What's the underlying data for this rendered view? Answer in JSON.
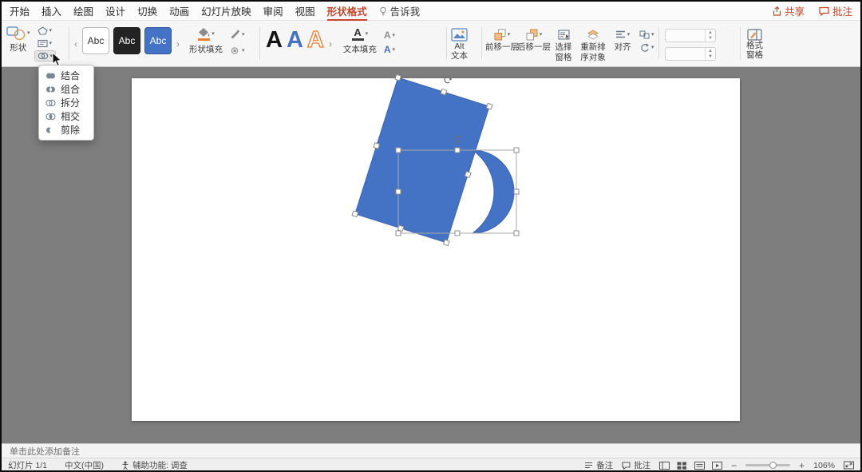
{
  "colors": {
    "accent_red": "#C8442C",
    "shape_blue": "#4472C4",
    "fill_swatch_orange": "#ED7D31"
  },
  "menubar": {
    "tabs": [
      "开始",
      "插入",
      "绘图",
      "设计",
      "切换",
      "动画",
      "幻灯片放映",
      "审阅",
      "视图",
      "形状格式",
      "告诉我"
    ],
    "share_label": "共享",
    "comments_label": "批注"
  },
  "ribbon": {
    "shapes_label": "形状",
    "style_samples": [
      "Abc",
      "Abc",
      "Abc"
    ],
    "shape_fill_label": "形状填充",
    "wordart_letters": [
      "A",
      "A",
      "A"
    ],
    "text_fill_label": "文本填充",
    "alt_text_lines": [
      "Alt",
      "文本"
    ],
    "bring_forward_label": "前移一层",
    "send_backward_label": "后移一层",
    "selection_pane_lines": [
      "选择",
      "窗格"
    ],
    "reorder_lines": [
      "重新排",
      "序对象"
    ],
    "align_label": "对齐",
    "format_pane_lines": [
      "格式",
      "窗格"
    ],
    "size_fields": {
      "height_value": "",
      "width_value": ""
    }
  },
  "merge_menu": {
    "items": [
      {
        "label": "结合"
      },
      {
        "label": "组合"
      },
      {
        "label": "拆分"
      },
      {
        "label": "相交"
      },
      {
        "label": "剪除"
      }
    ]
  },
  "slide": {
    "shapes": [
      {
        "type": "rotated-rectangle",
        "fill": "#4472C4"
      },
      {
        "type": "moon",
        "fill": "#4472C4"
      }
    ]
  },
  "notes": {
    "placeholder": "单击此处添加备注"
  },
  "statusbar": {
    "slide_counter": "幻灯片 1/1",
    "language": "中文(中国)",
    "accessibility": "辅助功能: 调查",
    "notes_label": "备注",
    "comments_label": "批注",
    "zoom_level": "106%"
  }
}
